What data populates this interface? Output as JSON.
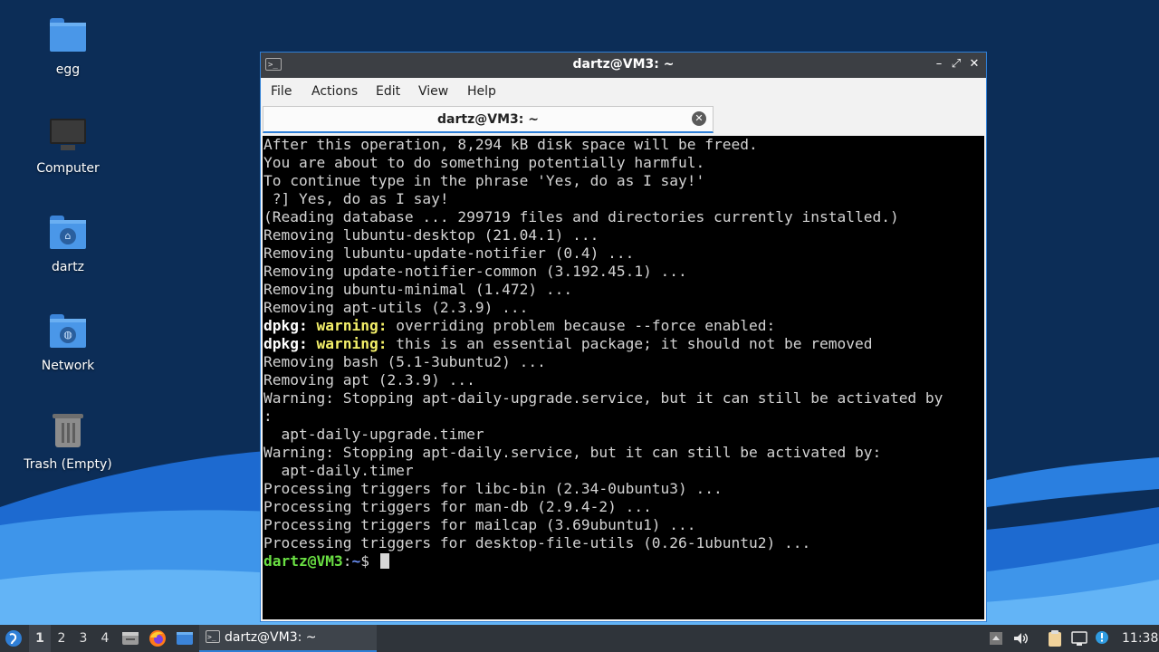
{
  "desktop": {
    "icons": [
      {
        "label": "egg",
        "icon": "folder-icon"
      },
      {
        "label": "Computer",
        "icon": "computer-icon"
      },
      {
        "label": "dartz",
        "icon": "home-folder-icon"
      },
      {
        "label": "Network",
        "icon": "network-folder-icon"
      },
      {
        "label": "Trash (Empty)",
        "icon": "trash-icon"
      }
    ]
  },
  "window": {
    "title": "dartz@VM3: ~",
    "controls": {
      "minimize": "–",
      "maximize": "⤢",
      "close": "✕"
    },
    "menu": [
      "File",
      "Actions",
      "Edit",
      "View",
      "Help"
    ],
    "tab": {
      "title": "dartz@VM3: ~",
      "close": "✕"
    }
  },
  "terminal": {
    "lines": [
      "After this operation, 8,294 kB disk space will be freed.",
      "You are about to do something potentially harmful.",
      "To continue type in the phrase 'Yes, do as I say!'",
      " ?] Yes, do as I say!",
      "(Reading database ... 299719 files and directories currently installed.)",
      "Removing lubuntu-desktop (21.04.1) ...",
      "Removing lubuntu-update-notifier (0.4) ...",
      "Removing update-notifier-common (3.192.45.1) ...",
      "Removing ubuntu-minimal (1.472) ...",
      "Removing apt-utils (2.3.9) ...",
      {
        "dpkg": "dpkg:",
        "warning": "warning:",
        "rest": " overriding problem because --force enabled:"
      },
      {
        "dpkg": "dpkg:",
        "warning": "warning:",
        "rest": " this is an essential package; it should not be removed"
      },
      "Removing bash (5.1-3ubuntu2) ...",
      "Removing apt (2.3.9) ...",
      "Warning: Stopping apt-daily-upgrade.service, but it can still be activated by",
      ":",
      "  apt-daily-upgrade.timer",
      "Warning: Stopping apt-daily.service, but it can still be activated by:",
      "  apt-daily.timer",
      "Processing triggers for libc-bin (2.34-0ubuntu3) ...",
      "Processing triggers for man-db (2.9.4-2) ...",
      "Processing triggers for mailcap (3.69ubuntu1) ...",
      "Processing triggers for desktop-file-utils (0.26-1ubuntu2) ..."
    ],
    "prompt": {
      "user": "dartz@VM3",
      "sep": ":",
      "path": "~",
      "symbol": "$ "
    },
    "colors": {
      "background": "#000000",
      "text": "#d3d3d3",
      "warning": "#f5f16a",
      "user": "#6ae043",
      "path": "#6a8ff5"
    }
  },
  "taskbar": {
    "workspaces": [
      "1",
      "2",
      "3",
      "4"
    ],
    "active_workspace": "1",
    "task": {
      "label": "dartz@VM3: ~"
    },
    "clock": "11:38",
    "launchers": [
      "file-manager-icon",
      "firefox-icon",
      "desktop-icon"
    ],
    "tray": [
      "up-arrow-icon",
      "volume-icon",
      "clipboard-icon",
      "network-icon",
      "update-icon"
    ]
  },
  "colors": {
    "accent": "#2f7fd6",
    "titlebar": "#3c3f44",
    "taskbar": "#2f343a",
    "desktop": "#0c2d57"
  }
}
